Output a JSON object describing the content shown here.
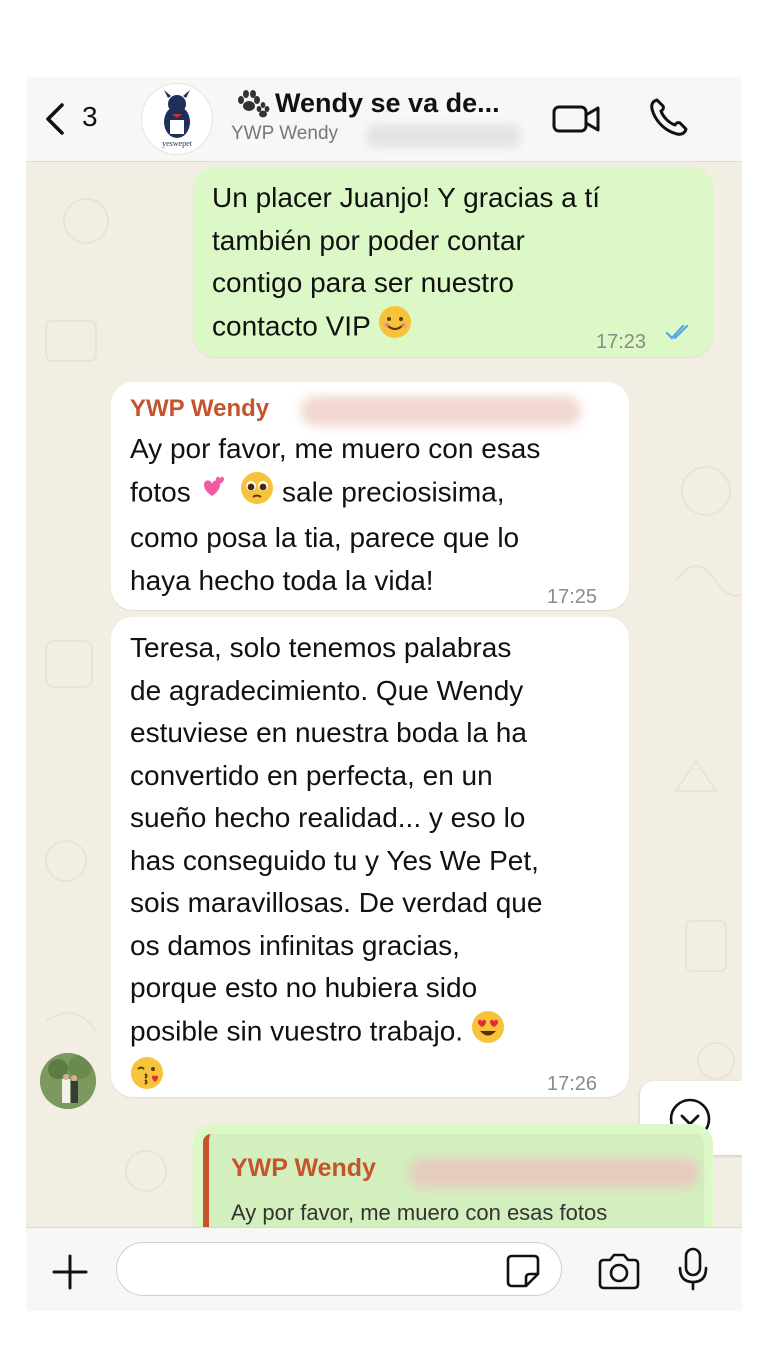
{
  "header": {
    "back_count": "3",
    "avatar_label": "yeswepet",
    "title": "Wendy se va de...",
    "subtitle": "YWP Wendy"
  },
  "messages": [
    {
      "direction": "outgoing",
      "lines": [
        "Un placer Juanjo! Y gracias a tí",
        "también por poder contar",
        "contigo para ser nuestro",
        "contacto VIP"
      ],
      "emoji_end": "😊",
      "time": "17:23",
      "status": "read-double-check"
    },
    {
      "direction": "incoming",
      "sender": "YWP Wendy",
      "lines": [
        "Ay por favor, me muero con esas",
        "fotos",
        "sale preciosisima,",
        "como posa la tia, parece que lo",
        "haya hecho toda la vida!"
      ],
      "emojis": [
        "💕",
        "🥹"
      ],
      "time": "17:25"
    },
    {
      "direction": "incoming",
      "lines": [
        "Teresa, solo tenemos palabras",
        "de agradecimiento. Que Wendy",
        "estuviese en nuestra boda la ha",
        "convertido en perfecta, en un",
        "sueño hecho realidad... y eso lo",
        "has conseguido tu y Yes We Pet,",
        "sois maravillosas. De verdad que",
        "os damos infinitas gracias,",
        "porque esto no hubiera sido",
        "posible sin vuestro trabajo."
      ],
      "emojis": [
        "😍",
        "😘"
      ],
      "time": "17:26"
    }
  ],
  "quoted_reply": {
    "sender": "YWP Wendy",
    "text": "Ay por favor, me muero con esas fotos"
  },
  "input": {
    "placeholder": "",
    "value": ""
  },
  "colors": {
    "outgoing_bubble": "#dcf8c6",
    "incoming_bubble": "#ffffff",
    "sender_name": "#c5532c",
    "read_ticks": "#4fa6e8",
    "chat_background": "#f3eee3"
  },
  "icons": [
    "chevron-left-icon",
    "paw-icon",
    "video-call-icon",
    "phone-icon",
    "double-check-icon",
    "chevron-down-icon",
    "plus-icon",
    "sticker-icon",
    "camera-icon",
    "microphone-icon"
  ]
}
